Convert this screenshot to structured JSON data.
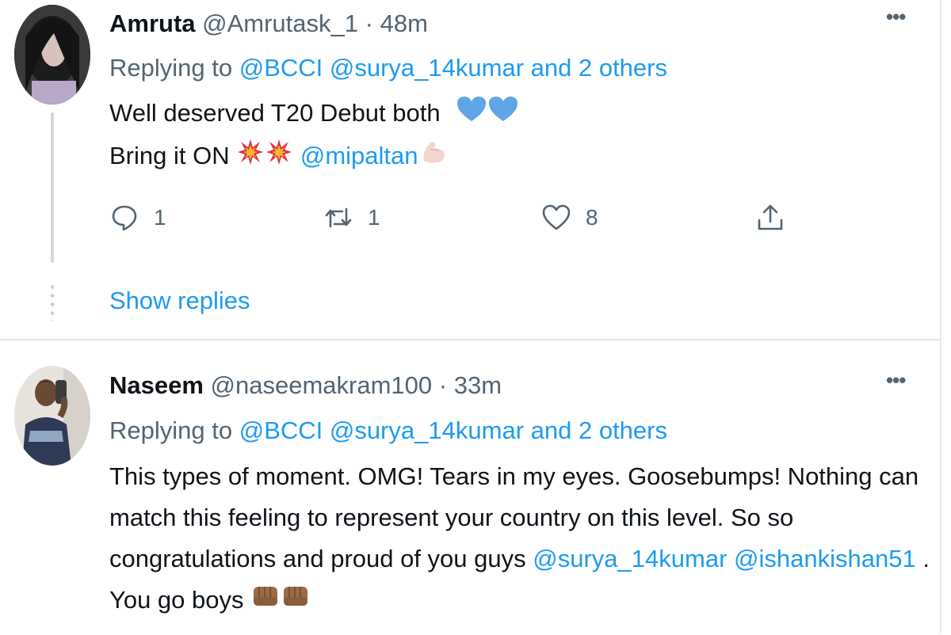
{
  "tweets": [
    {
      "name": "Amruta",
      "handle": "@Amrutask_1",
      "separator": "·",
      "time": "48m",
      "more": "•••",
      "replying_prefix": "Replying to",
      "replying_users": [
        "@BCCI",
        "@surya_14kumar",
        "and 2 others"
      ],
      "body": {
        "line1": "Well deserved T20 Debut both",
        "line2_text": "Bring it ON",
        "line2_mention": "@mipaltan"
      },
      "actions": {
        "replies": "1",
        "retweets": "1",
        "likes": "8"
      },
      "show_replies": "Show replies",
      "icons": [
        "heart-emoji",
        "collision-emoji",
        "flexed-biceps-emoji",
        "reply-icon",
        "retweet-icon",
        "like-icon",
        "share-icon"
      ]
    },
    {
      "name": "Naseem",
      "handle": "@naseemakram100",
      "separator": "·",
      "time": "33m",
      "more": "•••",
      "replying_prefix": "Replying to",
      "replying_users": [
        "@BCCI",
        "@surya_14kumar",
        "and 2 others"
      ],
      "body": {
        "line1": "This types of moment. OMG! Tears in my eyes. Goosebumps! Nothing can",
        "line2": "match this feeling to represent your country on this level. So so",
        "line3_text": "congratulations and proud of you guys",
        "line3_mention1": "@surya_14kumar",
        "line3_mention2": "@ishankishan51",
        "line3_end": ".",
        "line4_text": "You go boys"
      },
      "icons": [
        "oncoming-fist-emoji"
      ]
    }
  ],
  "colors": {
    "link": "#1d9bf0",
    "muted": "#536471",
    "text": "#0f1419",
    "heart": "#5ea6e6"
  }
}
